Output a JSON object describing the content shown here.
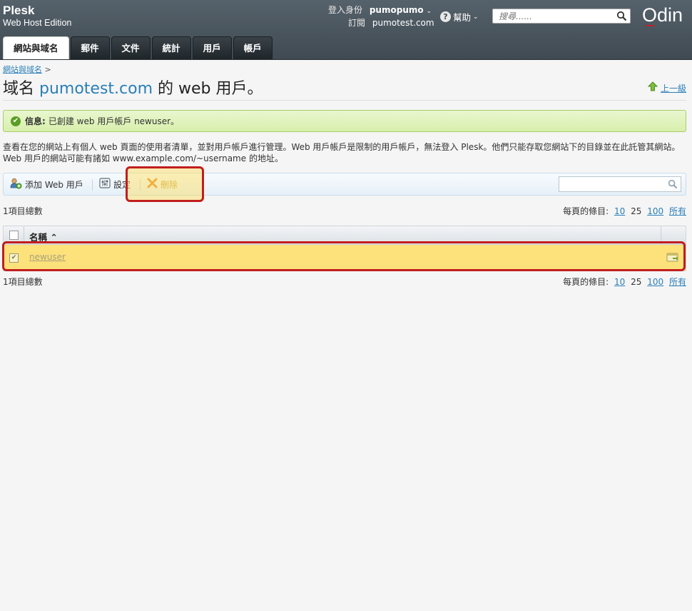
{
  "header": {
    "brand_name": "Plesk",
    "brand_sub": "Web Host Edition",
    "login_label": "登入身份",
    "login_user": "pumopumo",
    "subscription_label": "訂閱",
    "subscription_value": "pumotest.com",
    "help_label": "幫助",
    "search_placeholder": "搜尋......",
    "logo": "Odin"
  },
  "tabs": [
    {
      "label": "網站與域名",
      "active": true
    },
    {
      "label": "郵件"
    },
    {
      "label": "文件"
    },
    {
      "label": "統計"
    },
    {
      "label": "用戶"
    },
    {
      "label": "帳戶"
    }
  ],
  "breadcrumb": {
    "link": "網站與域名",
    "sep": ">"
  },
  "title": {
    "prefix": "域名 ",
    "domain": "pumotest.com",
    "suffix": " 的 web 用戶。"
  },
  "up_level": "上一級",
  "message": {
    "label": "信息:",
    "text": "已創建 web 用戶帳戶 newuser。"
  },
  "description": "查看在您的網站上有個人 web 頁面的使用者清單，並對用戶帳戶進行管理。Web 用戶帳戶是限制的用戶帳戶，無法登入 Plesk。他們只能存取您網站下的目錄並在此託管其網站。Web 用戶的網站可能有諸如 www.example.com/~username 的地址。",
  "toolbar": {
    "add_label": "添加 Web 用戶",
    "settings_label": "設定",
    "delete_label": "刪除"
  },
  "list": {
    "total": "1項目總數",
    "per_page_label": "每頁的條目:",
    "per_page_options": [
      "10",
      "25",
      "100",
      "所有"
    ],
    "per_page_current": "25",
    "column_name": "名稱 ⌃",
    "rows": [
      {
        "name": "newuser",
        "checked": true
      }
    ]
  }
}
